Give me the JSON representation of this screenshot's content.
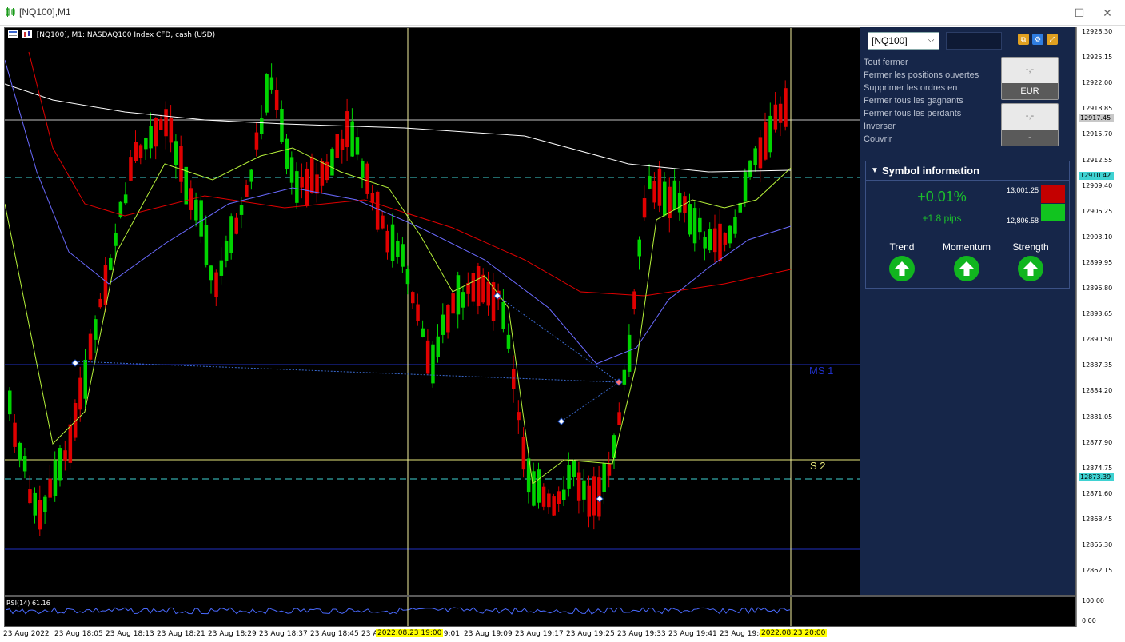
{
  "window": {
    "title": "[NQ100],M1"
  },
  "chart": {
    "header": "[NQ100], M1:  NASDAQ100 Index CFD, cash (USD)",
    "price_ticks": [
      "12928.30",
      "12925.15",
      "12922.00",
      "12918.85",
      "12915.70",
      "12912.55",
      "12909.40",
      "12906.25",
      "12903.10",
      "12899.95",
      "12896.80",
      "12893.65",
      "12890.50",
      "12887.35",
      "12884.20",
      "12881.05",
      "12877.90",
      "12874.75",
      "12871.60",
      "12868.45",
      "12865.30",
      "12862.15"
    ],
    "price_badges": [
      {
        "value": "12917.45",
        "color": "#c8c8c8"
      },
      {
        "value": "12910.42",
        "color": "#3fd2d2"
      },
      {
        "value": "12873.39",
        "color": "#3fd2d2"
      }
    ],
    "level_labels": {
      "ms1": "MS 1",
      "s2": "S 2"
    },
    "rsi": {
      "label": "RSI(14) 61.16",
      "ticks": [
        "100.00",
        "0.00"
      ]
    },
    "time_ticks": [
      "23 Aug 2022",
      "23 Aug 18:05",
      "23 Aug 18:13",
      "23 Aug 18:21",
      "23 Aug 18:29",
      "23 Aug 18:37",
      "23 Aug 18:45",
      "23 A",
      "19:01",
      "23 Aug 19:09",
      "23 Aug 19:17",
      "23 Aug 19:25",
      "23 Aug 19:33",
      "23 Aug 19:41",
      "23 Aug 19:4"
    ],
    "time_markers": [
      "2022.08.23 19:00",
      "2022.08.23 20:00"
    ],
    "colors": {
      "bull": "#00d400",
      "bear": "#e00000",
      "ma_slow": "#ffffff",
      "ma_mid": "#e00000",
      "ma_blue": "#6a6aff",
      "ma_fast": "#b6f23a"
    }
  },
  "panel": {
    "symbol": "[NQ100]",
    "close_actions": [
      "Tout fermer",
      "Fermer les positions ouvertes",
      "Supprimer les ordres en",
      "Fermer tous les gagnants",
      "Fermer tous les perdants",
      "Inverser",
      "Couvrir"
    ],
    "box1": {
      "value": "-,-",
      "unit": "EUR"
    },
    "box2": {
      "value": "-,-",
      "unit": "-"
    },
    "symbol_info": {
      "title": "Symbol information",
      "change_pct": "+0.01%",
      "change_pips": "+1.8 pips",
      "high": "13,001.25",
      "low": "12,806.58",
      "indicators": [
        {
          "label": "Trend",
          "state": "up-arrow-icon"
        },
        {
          "label": "Momentum",
          "state": "up-arrow-icon"
        },
        {
          "label": "Strength",
          "state": "up-arrow-icon"
        }
      ]
    }
  }
}
